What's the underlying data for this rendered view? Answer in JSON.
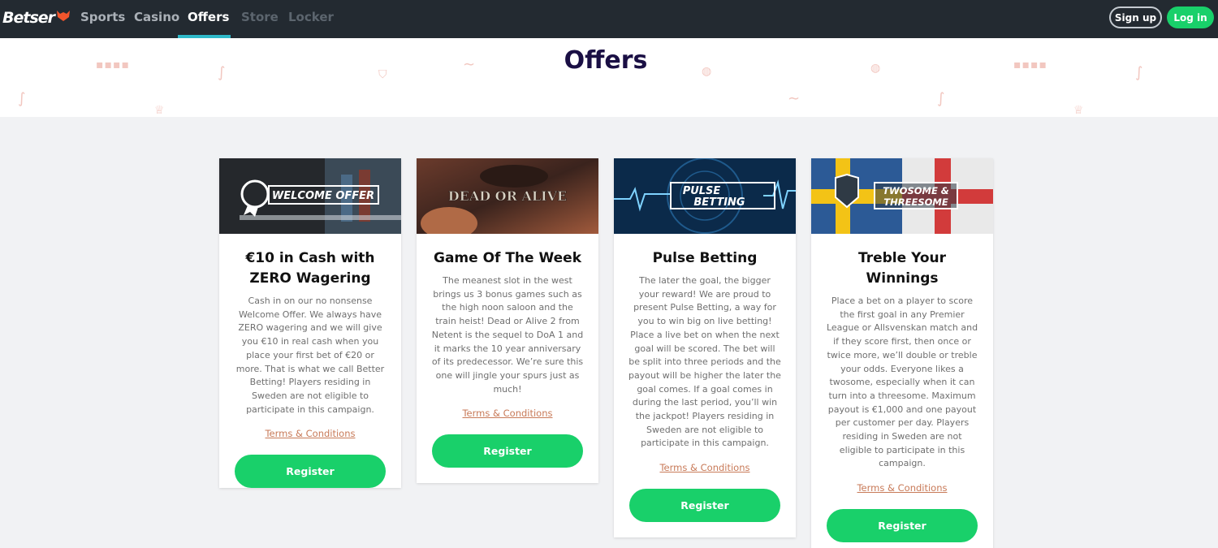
{
  "brand": {
    "logo_text": "Betser",
    "accent": "#19d06a",
    "nav_bg": "#232a31",
    "title_color": "#1a0f44",
    "link_color": "#c87a58"
  },
  "nav": {
    "items": [
      {
        "label": "Sports",
        "state": "normal"
      },
      {
        "label": "Casino",
        "state": "normal"
      },
      {
        "label": "Offers",
        "state": "active"
      },
      {
        "label": "Store",
        "state": "disabled"
      },
      {
        "label": "Locker",
        "state": "disabled"
      }
    ],
    "signup_label": "Sign up",
    "login_label": "Log in"
  },
  "page": {
    "title": "Offers"
  },
  "offers": [
    {
      "banner_text": "WELCOME OFFER",
      "title": "€10 in Cash with ZERO Wagering",
      "description": "Cash in on our no nonsense Welcome Offer. We always have ZERO wagering and we will give you €10 in real cash when you place your first bet of €20 or more. That is what we call Better Betting! Players residing in Sweden are not eligible to participate in this campaign.",
      "terms_label": "Terms & Conditions",
      "register_label": "Register"
    },
    {
      "banner_text": "DEAD OR ALIVE",
      "title": "Game Of The Week",
      "description": "The meanest slot in the west brings us 3 bonus games such as the high noon saloon and the train heist! Dead or Alive 2 from Netent is the sequel to DoA 1 and it marks the 10 year anniversary of its predecessor. We’re sure this one will jingle your spurs just as much!",
      "terms_label": "Terms & Conditions",
      "register_label": "Register"
    },
    {
      "banner_text_line1": "PULSE",
      "banner_text_line2": "BETTING",
      "title": "Pulse Betting",
      "description": "The later the goal, the bigger your reward! We are proud to present Pulse Betting, a way for you to win big on live betting! Place a live bet on when the next goal will be scored. The bet will be split into three periods and the payout will be higher the later the goal comes. If a goal comes in during the last period, you’ll win the jackpot! Players residing in Sweden are not eligible to participate in this campaign.",
      "terms_label": "Terms & Conditions",
      "register_label": "Register"
    },
    {
      "banner_text_line1": "TWOSOME &",
      "banner_text_line2": "THREESOME",
      "title": "Treble Your Winnings",
      "description": "Place a bet on a player to score the first goal in any Premier League or Allsvenskan match and if they score first, then once or twice more, we’ll double or treble your odds. Everyone likes a twosome, especially when it can turn into a threesome. Maximum payout is €1,000 and one payout per customer per day. Players residing in Sweden are not eligible to participate in this campaign.",
      "terms_label": "Terms & Conditions",
      "register_label": "Register"
    }
  ]
}
